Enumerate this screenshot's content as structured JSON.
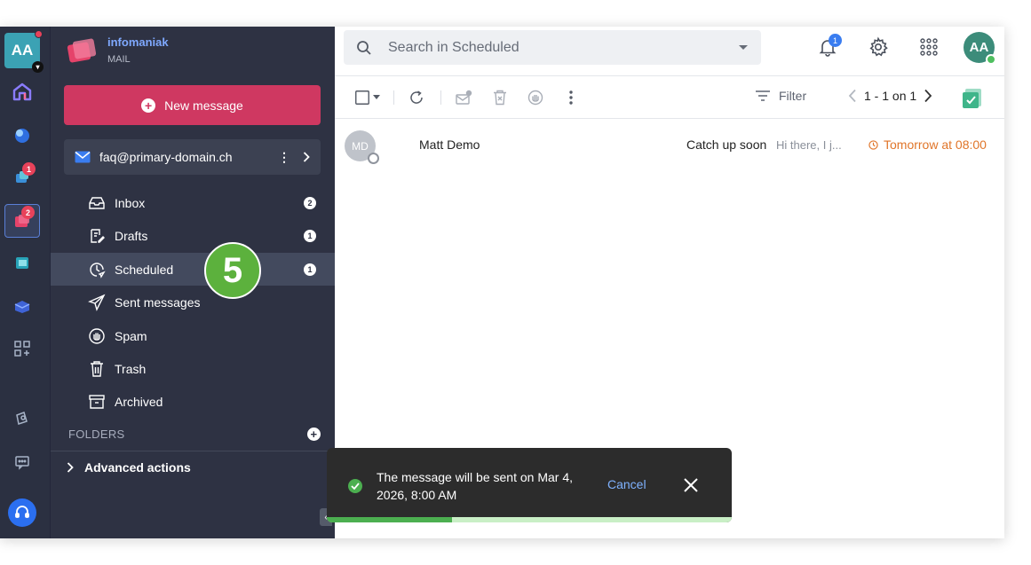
{
  "rail": {
    "avatar_initials": "AA",
    "icons": [
      {
        "name": "home-icon"
      },
      {
        "name": "drive-icon"
      },
      {
        "name": "swiss-transfer-icon",
        "badge": "1"
      },
      {
        "name": "mail-app-icon",
        "badge": "2",
        "active": true
      },
      {
        "name": "calendar-icon"
      },
      {
        "name": "kdrive-icon"
      },
      {
        "name": "apps-add-icon"
      },
      {
        "name": "contacts-icon"
      },
      {
        "name": "chat-icon"
      },
      {
        "name": "support-icon"
      }
    ]
  },
  "brand": {
    "name": "infomaniak",
    "product": "MAIL"
  },
  "sidebar": {
    "new_message": "New message",
    "account_email": "faq@primary-domain.ch",
    "folders": [
      {
        "label": "Inbox",
        "count": "2",
        "icon": "inbox-icon"
      },
      {
        "label": "Drafts",
        "count": "1",
        "icon": "drafts-icon"
      },
      {
        "label": "Scheduled",
        "count": "1",
        "icon": "scheduled-icon",
        "selected": true
      },
      {
        "label": "Sent messages",
        "icon": "sent-icon"
      },
      {
        "label": "Spam",
        "icon": "spam-icon"
      },
      {
        "label": "Trash",
        "icon": "trash-icon"
      },
      {
        "label": "Archived",
        "icon": "archive-icon"
      }
    ],
    "folders_header": "FOLDERS",
    "advanced_actions": "Advanced actions",
    "step_number": "5"
  },
  "header": {
    "search_placeholder": "Search in Scheduled",
    "notification_count": "1",
    "user_initials": "AA"
  },
  "toolbar": {
    "filter_label": "Filter",
    "pagination": "1 - 1 on 1"
  },
  "messages": [
    {
      "avatar_initials": "MD",
      "sender": "Matt Demo",
      "subject": "Catch up soon",
      "preview": "Hi there, I j...",
      "scheduled_time": "Tomorrow at 08:00"
    }
  ],
  "toast": {
    "message": "The message will be sent on Mar 4, 2026, 8:00 AM",
    "cancel_label": "Cancel",
    "progress": 0.31
  },
  "colors": {
    "accent": "#cf3861",
    "sidebar_bg": "#2e3243",
    "rail_bg": "#2b3041",
    "scheduled_orange": "#e07529",
    "success_green": "#4caf50"
  }
}
